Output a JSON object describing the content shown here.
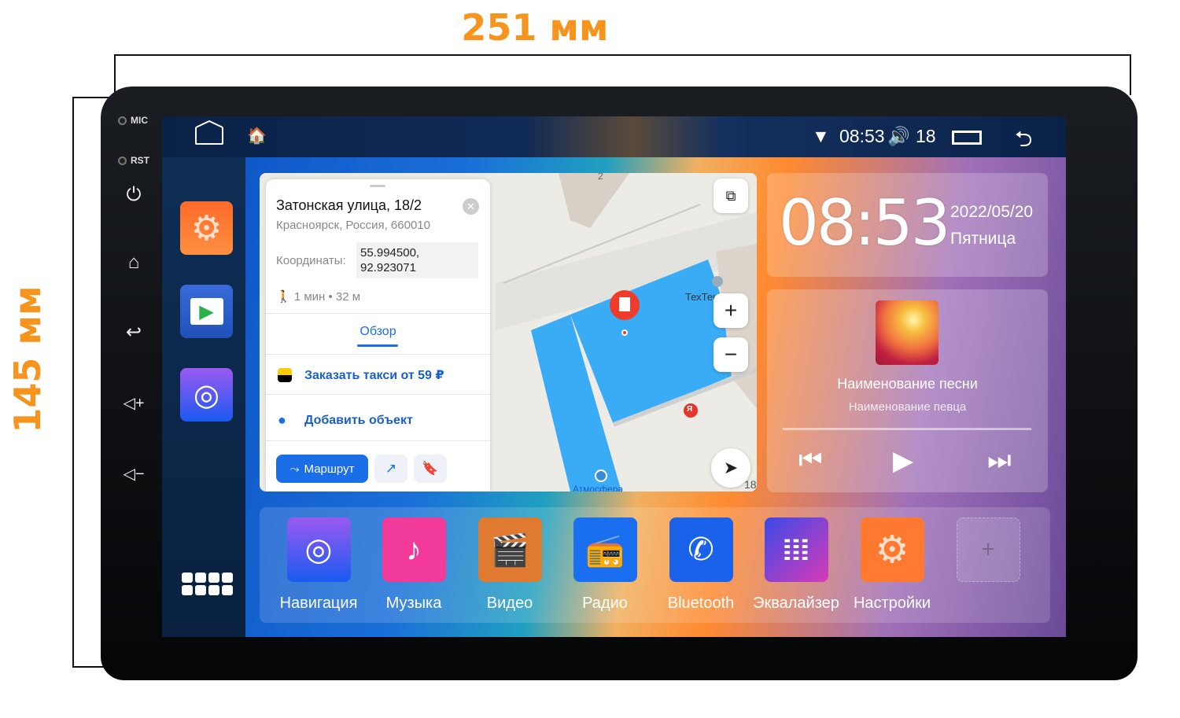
{
  "dimensions": {
    "width": "251 мм",
    "height": "145 мм"
  },
  "hardware": {
    "mic": "MIC",
    "rst": "RST"
  },
  "status_bar": {
    "time": "08:53",
    "volume": "18",
    "icons": [
      "home-outline-icon",
      "launcher-home-icon",
      "wifi-icon",
      "volume-icon",
      "recent-apps-icon",
      "back-icon"
    ]
  },
  "map_card": {
    "title": "Затонская улица, 18/2",
    "subtitle": "Красноярск, Россия, 660010",
    "coords_label": "Координаты:",
    "coords_lat": "55.994500,",
    "coords_lon": "92.923071",
    "walk": "1 мин • 32 м",
    "tab": "Обзор",
    "taxi": "Заказать такси от 59 ₽",
    "add": "Добавить объект",
    "route": "Маршрут",
    "map_labels": {
      "top": "2",
      "poi": "ТехТекстиль",
      "bottom": "Атмосфера",
      "corner": "18",
      "yandex": "Я"
    }
  },
  "clock_widget": {
    "time": "08:53",
    "date": "2022/05/20",
    "weekday": "Пятница"
  },
  "music_widget": {
    "song": "Наименование песни",
    "artist": "Наименование певца",
    "progress": 0
  },
  "dock_apps": [
    {
      "label": "Навигация",
      "color": "#4a5cf0"
    },
    {
      "label": "Музыка",
      "color": "#f23a9a"
    },
    {
      "label": "Видео",
      "color": "#e07a30"
    },
    {
      "label": "Радио",
      "color": "#1a6ef0"
    },
    {
      "label": "Bluetooth",
      "color": "#1a62ea"
    },
    {
      "label": "Эквалайзер",
      "color": "#8a3ad8"
    },
    {
      "label": "Настройки",
      "color": "#ff7a30"
    }
  ],
  "accent": "#f7941d"
}
